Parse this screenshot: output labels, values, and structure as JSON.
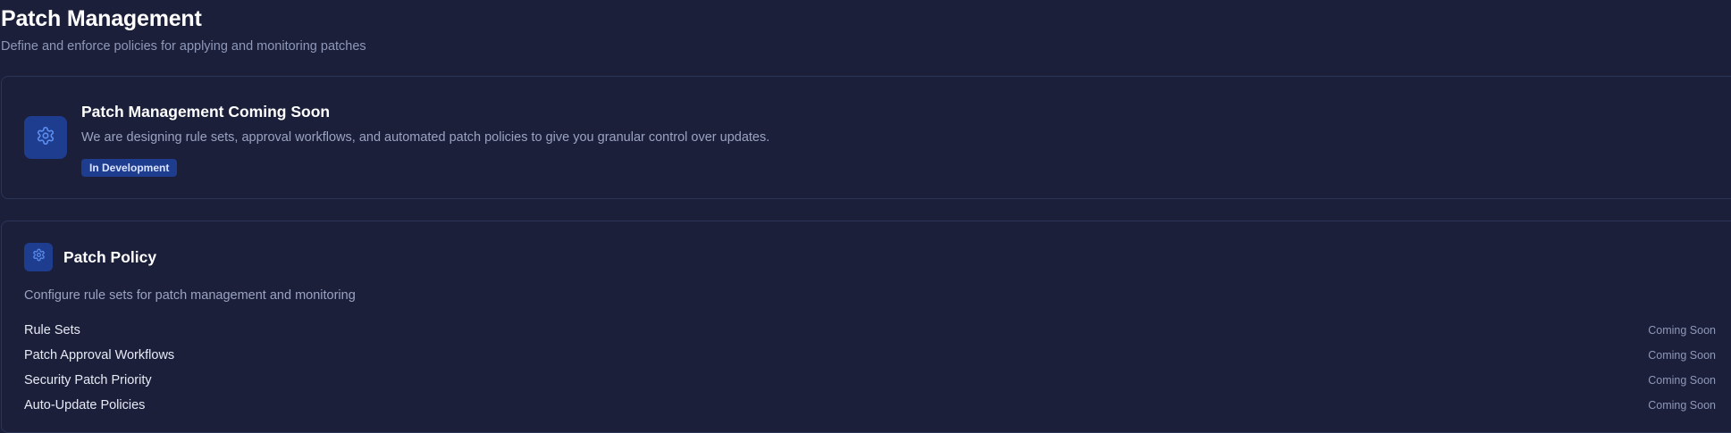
{
  "header": {
    "title": "Patch Management",
    "subtitle": "Define and enforce policies for applying and monitoring patches"
  },
  "coming_soon_card": {
    "icon": "gear-icon",
    "title": "Patch Management Coming Soon",
    "description": "We are designing rule sets, approval workflows, and automated patch policies to give you granular control over updates.",
    "badge": "In Development"
  },
  "policy_card": {
    "icon": "gear-icon",
    "title": "Patch Policy",
    "description": "Configure rule sets for patch management and monitoring",
    "items": [
      {
        "label": "Rule Sets",
        "status": "Coming Soon"
      },
      {
        "label": "Patch Approval Workflows",
        "status": "Coming Soon"
      },
      {
        "label": "Security Patch Priority",
        "status": "Coming Soon"
      },
      {
        "label": "Auto-Update Policies",
        "status": "Coming Soon"
      }
    ]
  },
  "colors": {
    "background": "#1b1f3a",
    "card_border": "#2b3557",
    "accent_tile": "#1f3d8f",
    "icon_stroke": "#5b8def",
    "muted_text": "#9aa3c0"
  }
}
